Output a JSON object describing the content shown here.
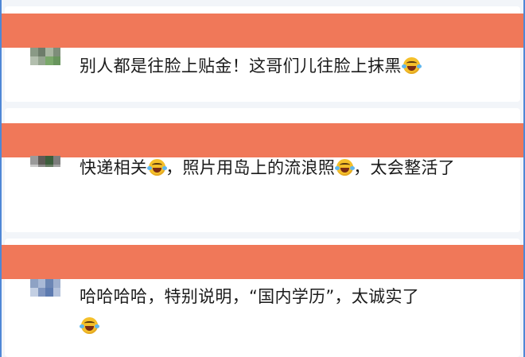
{
  "comments": [
    {
      "segments": [
        "别人都是往脸上贴金！这哥们儿往脸上抹黑",
        ""
      ],
      "emoji_icon": "crying-laughing-face"
    },
    {
      "segments": [
        "快递相关",
        "，照片用岛上的流浪照",
        "，太会整活了"
      ],
      "emoji_icon": "crying-laughing-face"
    },
    {
      "segments": [
        "哈哈哈哈，特别说明，“国内学历”，太诚实了",
        ""
      ],
      "emoji_icon": "crying-laughing-face"
    }
  ],
  "colors": {
    "redaction_banner": "#f07859",
    "card_background": "#ffffff",
    "page_background": "#f2f5f9",
    "frame_border": "#4f87d6"
  }
}
